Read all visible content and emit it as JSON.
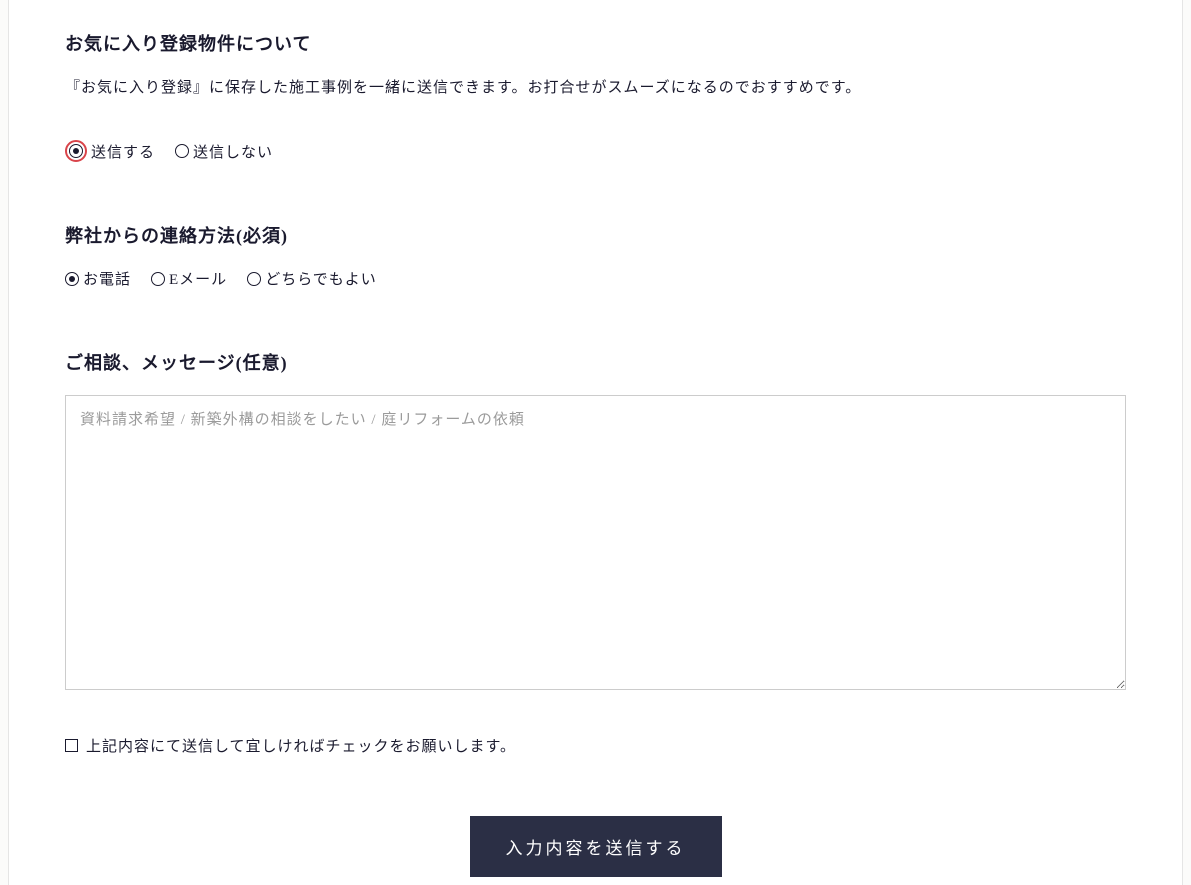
{
  "favorites": {
    "heading": "お気に入り登録物件について",
    "description": "『お気に入り登録』に保存した施工事例を一緒に送信できます。お打合せがスムーズになるのでおすすめです。",
    "options": {
      "send": "送信する",
      "dont_send": "送信しない"
    }
  },
  "contact_method": {
    "heading": "弊社からの連絡方法(必須)",
    "options": {
      "phone": "お電話",
      "email": "Eメール",
      "either": "どちらでもよい"
    }
  },
  "message": {
    "heading": "ご相談、メッセージ(任意)",
    "placeholder": "資料請求希望 / 新築外構の相談をしたい / 庭リフォームの依頼"
  },
  "confirm": {
    "label": "上記内容にて送信して宜しければチェックをお願いします。"
  },
  "submit": {
    "label": "入力内容を送信する"
  }
}
